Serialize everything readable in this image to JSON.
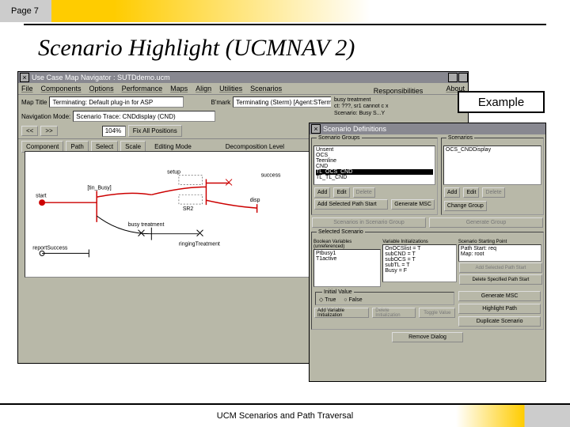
{
  "page_label": "Page 7",
  "title": "Scenario Highlight (UCMNAV 2)",
  "example_label": "Example",
  "footer": "UCM Scenarios and Path Traversal",
  "nav": {
    "title": "Use Case Map Navigator : SUTDdemo.ucm",
    "menu": [
      "File",
      "Components",
      "Options",
      "Performance",
      "Maps",
      "Align",
      "Utilities",
      "Scenarios",
      "About"
    ],
    "map_title_label": "Map Title",
    "map_title_value": "Terminating: Default plug-in for ASP",
    "nav_mode_label": "Navigation Mode:",
    "nav_mode_value": "Scenario Trace: CNDdisplay (CND)",
    "toolbar": {
      "component": "Component",
      "path": "Path",
      "select": "Select",
      "scale": "Scale",
      "zoom": "104%",
      "fix": "Fix All Positions",
      "edit_mode": "Editing Mode",
      "decomp": "Decomposition Level",
      "bmark": "B'mark",
      "terminating": "Terminating (Sterm) [Agent:STerm]"
    }
  },
  "diagram": {
    "nodes": {
      "start": "start",
      "tin_busy": "[tin_Busy]",
      "busy_treatment": "busy treatment",
      "ringing_treatment": "ringingTreatment",
      "report_success": "reportSuccess",
      "disp": "disp",
      "sr2": "SR2",
      "setup": "setup",
      "success": "success"
    }
  },
  "resp": {
    "header": "Responsibilities",
    "line1": "busy treatment",
    "line2": "ct: ???, sr1 cannot c x",
    "line3": "Scenario: Busy S...Y"
  },
  "scen": {
    "title": "Scenario Definitions",
    "groups_label": "Scenario Groups",
    "scenarios_label": "Scenarios",
    "groups": [
      "Unsent",
      "OCS",
      "Teenline",
      "CND",
      "TL_OCS_CND",
      "TL_TL_CND"
    ],
    "groups_selected": "TL_OCS_CND",
    "scenarios": [
      "OCS_CNDDisplay"
    ],
    "btn_add": "Add",
    "btn_edit": "Edit",
    "btn_delete": "Delete",
    "btn_change_group": "Change Group",
    "btn_add_sel_path": "Add Selected Path Start",
    "btn_generate_msc": "Generate MSC",
    "btn_scen_group": "Scenarios in Scenario Group",
    "btn_gen_group": "Generate Group",
    "selected_scenario": "Selected Scenario",
    "bool_vars_label": "Boolean Variables (unreferenced)",
    "var_init_label": "Variable Initializations",
    "start_point_label": "Scenario Starting Point",
    "bool_vars": [
      "Ptbusy1",
      "T1active"
    ],
    "var_inits": [
      "OnOCSlist = T",
      "subCND = T",
      "subOCS = T",
      "subTL = T",
      "Busy = F"
    ],
    "start_points": [
      "Path Start: req",
      "Map: root"
    ],
    "btn_add_sel_path2": "Add Selected Path Start",
    "btn_del_spec_path": "Delete Specified Path Start",
    "initial_value": "Initial Value",
    "true": "True",
    "false": "False",
    "btn_add_var": "Add Variable Initialization",
    "btn_del_init": "Delete Initialization",
    "btn_toggle": "Toggle Value",
    "btn_gen_msc2": "Generate MSC",
    "btn_highlight": "Highlight Path",
    "btn_dup": "Duplicate Scenario",
    "btn_remove": "Remove Dialog"
  }
}
